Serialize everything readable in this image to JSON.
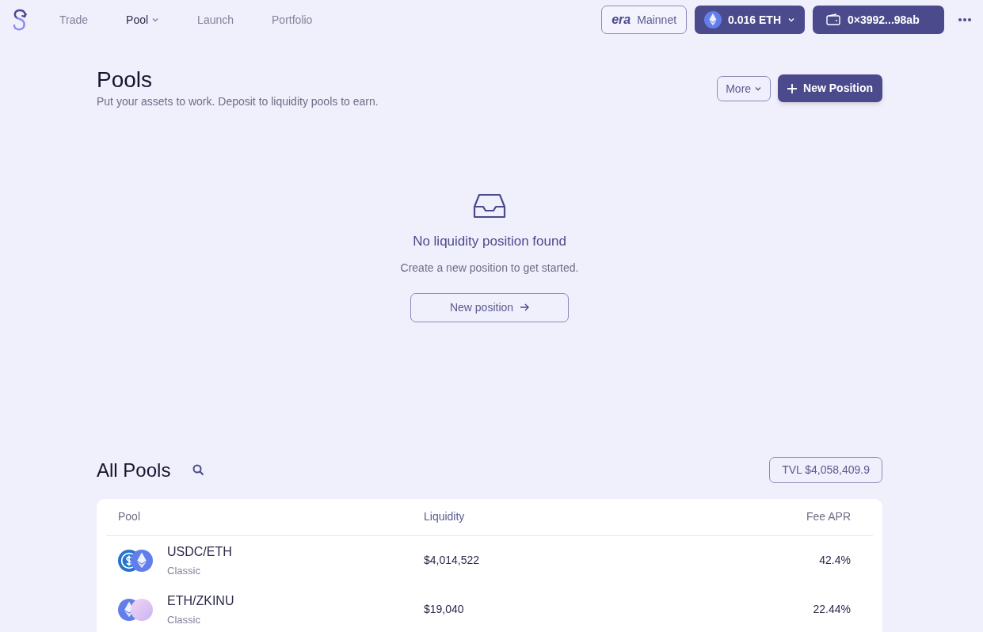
{
  "nav": {
    "items": [
      {
        "label": "Trade",
        "selected": false,
        "dropdown": false
      },
      {
        "label": "Pool",
        "selected": true,
        "dropdown": true
      },
      {
        "label": "Launch",
        "selected": false,
        "dropdown": false
      },
      {
        "label": "Portfolio",
        "selected": false,
        "dropdown": false
      }
    ],
    "network": {
      "logo": "era",
      "label": "Mainnet"
    },
    "balance": "0.016 ETH",
    "wallet": "0×3992...98ab"
  },
  "header": {
    "title": "Pools",
    "subtitle": "Put your assets to work. Deposit to liquidity pools to earn.",
    "more": "More",
    "new_position": "New Position"
  },
  "empty": {
    "title": "No liquidity position found",
    "text": "Create a new position to get started.",
    "button": "New position"
  },
  "all_pools": {
    "title": "All Pools",
    "tvl": "TVL $4,058,409.9",
    "columns": [
      {
        "label": "Pool",
        "selected": false
      },
      {
        "label": "Liquidity",
        "selected": true
      },
      {
        "label": "Fee APR",
        "selected": false
      }
    ],
    "rows": [
      {
        "pair": "USDC/ETH",
        "type": "Classic",
        "liquidity": "$4,014,522",
        "apr": "42.4%",
        "tokens": [
          {
            "kind": "usdc"
          },
          {
            "kind": "eth"
          }
        ]
      },
      {
        "pair": "ETH/ZKINU",
        "type": "Classic",
        "liquidity": "$19,040",
        "apr": "22.44%",
        "tokens": [
          {
            "kind": "eth"
          },
          {
            "kind": "orb"
          }
        ]
      }
    ]
  }
}
